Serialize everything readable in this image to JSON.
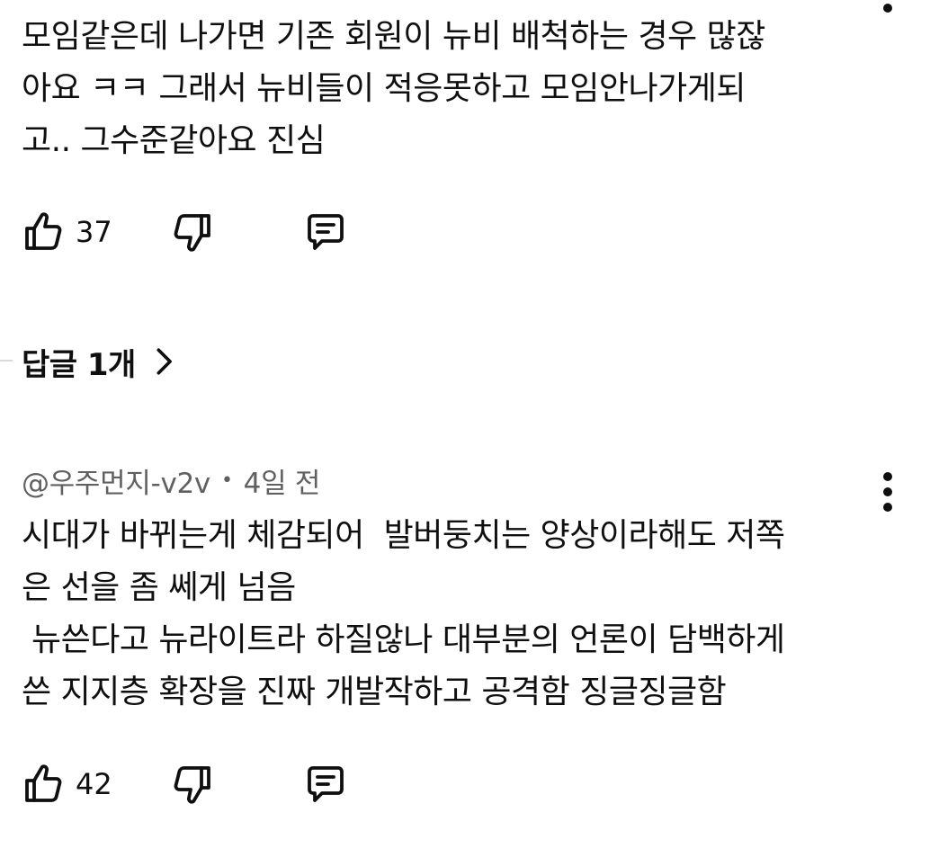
{
  "comment_top": {
    "text": "모임같은데 나가면 기존 회원이 뉴비 배척하는 경우 많잖\n아요 ㅋㅋ 그래서 뉴비들이 적응못하고 모임안나가게되\n고.. 그수준같아요 진심",
    "like_count": "37"
  },
  "replies_toggle": {
    "label": "답글 1개"
  },
  "comment_second": {
    "author": "@우주먼지-v2v",
    "separator": "•",
    "time": "4일 전",
    "text": "시대가 바뀌는게 체감되어  발버둥치는 양상이라해도 저쪽\n은 선을 좀 쎄게 넘음\n 뉴쓴다고 뉴라이트라 하질않나 대부분의 언론이 담백하게\n쓴 지지층 확장을 진짜 개발작하고 공격함 징글징글함",
    "like_count": "42"
  },
  "icons": {
    "like": "thumb-up-icon",
    "dislike": "thumb-down-icon",
    "reply": "comment-reply-icon",
    "more": "more-vertical-icon",
    "chevron": "chevron-right-icon"
  },
  "colors": {
    "text": "#0f0f0f",
    "meta": "#606060",
    "background": "#ffffff"
  }
}
